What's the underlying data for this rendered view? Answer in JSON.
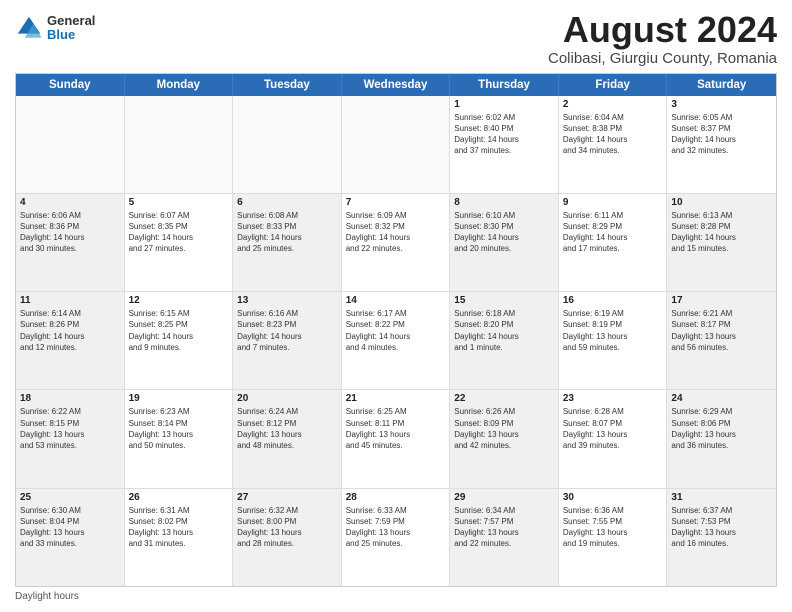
{
  "logo": {
    "general": "General",
    "blue": "Blue"
  },
  "title": "August 2024",
  "subtitle": "Colibasi, Giurgiu County, Romania",
  "calendar": {
    "headers": [
      "Sunday",
      "Monday",
      "Tuesday",
      "Wednesday",
      "Thursday",
      "Friday",
      "Saturday"
    ],
    "rows": [
      [
        {
          "day": "",
          "info": "",
          "empty": true
        },
        {
          "day": "",
          "info": "",
          "empty": true
        },
        {
          "day": "",
          "info": "",
          "empty": true
        },
        {
          "day": "",
          "info": "",
          "empty": true
        },
        {
          "day": "1",
          "info": "Sunrise: 6:02 AM\nSunset: 8:40 PM\nDaylight: 14 hours\nand 37 minutes."
        },
        {
          "day": "2",
          "info": "Sunrise: 6:04 AM\nSunset: 8:38 PM\nDaylight: 14 hours\nand 34 minutes."
        },
        {
          "day": "3",
          "info": "Sunrise: 6:05 AM\nSunset: 8:37 PM\nDaylight: 14 hours\nand 32 minutes."
        }
      ],
      [
        {
          "day": "4",
          "info": "Sunrise: 6:06 AM\nSunset: 8:36 PM\nDaylight: 14 hours\nand 30 minutes.",
          "shaded": true
        },
        {
          "day": "5",
          "info": "Sunrise: 6:07 AM\nSunset: 8:35 PM\nDaylight: 14 hours\nand 27 minutes."
        },
        {
          "day": "6",
          "info": "Sunrise: 6:08 AM\nSunset: 8:33 PM\nDaylight: 14 hours\nand 25 minutes.",
          "shaded": true
        },
        {
          "day": "7",
          "info": "Sunrise: 6:09 AM\nSunset: 8:32 PM\nDaylight: 14 hours\nand 22 minutes."
        },
        {
          "day": "8",
          "info": "Sunrise: 6:10 AM\nSunset: 8:30 PM\nDaylight: 14 hours\nand 20 minutes.",
          "shaded": true
        },
        {
          "day": "9",
          "info": "Sunrise: 6:11 AM\nSunset: 8:29 PM\nDaylight: 14 hours\nand 17 minutes."
        },
        {
          "day": "10",
          "info": "Sunrise: 6:13 AM\nSunset: 8:28 PM\nDaylight: 14 hours\nand 15 minutes.",
          "shaded": true
        }
      ],
      [
        {
          "day": "11",
          "info": "Sunrise: 6:14 AM\nSunset: 8:26 PM\nDaylight: 14 hours\nand 12 minutes.",
          "shaded": true
        },
        {
          "day": "12",
          "info": "Sunrise: 6:15 AM\nSunset: 8:25 PM\nDaylight: 14 hours\nand 9 minutes."
        },
        {
          "day": "13",
          "info": "Sunrise: 6:16 AM\nSunset: 8:23 PM\nDaylight: 14 hours\nand 7 minutes.",
          "shaded": true
        },
        {
          "day": "14",
          "info": "Sunrise: 6:17 AM\nSunset: 8:22 PM\nDaylight: 14 hours\nand 4 minutes."
        },
        {
          "day": "15",
          "info": "Sunrise: 6:18 AM\nSunset: 8:20 PM\nDaylight: 14 hours\nand 1 minute.",
          "shaded": true
        },
        {
          "day": "16",
          "info": "Sunrise: 6:19 AM\nSunset: 8:19 PM\nDaylight: 13 hours\nand 59 minutes."
        },
        {
          "day": "17",
          "info": "Sunrise: 6:21 AM\nSunset: 8:17 PM\nDaylight: 13 hours\nand 56 minutes.",
          "shaded": true
        }
      ],
      [
        {
          "day": "18",
          "info": "Sunrise: 6:22 AM\nSunset: 8:15 PM\nDaylight: 13 hours\nand 53 minutes.",
          "shaded": true
        },
        {
          "day": "19",
          "info": "Sunrise: 6:23 AM\nSunset: 8:14 PM\nDaylight: 13 hours\nand 50 minutes."
        },
        {
          "day": "20",
          "info": "Sunrise: 6:24 AM\nSunset: 8:12 PM\nDaylight: 13 hours\nand 48 minutes.",
          "shaded": true
        },
        {
          "day": "21",
          "info": "Sunrise: 6:25 AM\nSunset: 8:11 PM\nDaylight: 13 hours\nand 45 minutes."
        },
        {
          "day": "22",
          "info": "Sunrise: 6:26 AM\nSunset: 8:09 PM\nDaylight: 13 hours\nand 42 minutes.",
          "shaded": true
        },
        {
          "day": "23",
          "info": "Sunrise: 6:28 AM\nSunset: 8:07 PM\nDaylight: 13 hours\nand 39 minutes."
        },
        {
          "day": "24",
          "info": "Sunrise: 6:29 AM\nSunset: 8:06 PM\nDaylight: 13 hours\nand 36 minutes.",
          "shaded": true
        }
      ],
      [
        {
          "day": "25",
          "info": "Sunrise: 6:30 AM\nSunset: 8:04 PM\nDaylight: 13 hours\nand 33 minutes.",
          "shaded": true
        },
        {
          "day": "26",
          "info": "Sunrise: 6:31 AM\nSunset: 8:02 PM\nDaylight: 13 hours\nand 31 minutes."
        },
        {
          "day": "27",
          "info": "Sunrise: 6:32 AM\nSunset: 8:00 PM\nDaylight: 13 hours\nand 28 minutes.",
          "shaded": true
        },
        {
          "day": "28",
          "info": "Sunrise: 6:33 AM\nSunset: 7:59 PM\nDaylight: 13 hours\nand 25 minutes."
        },
        {
          "day": "29",
          "info": "Sunrise: 6:34 AM\nSunset: 7:57 PM\nDaylight: 13 hours\nand 22 minutes.",
          "shaded": true
        },
        {
          "day": "30",
          "info": "Sunrise: 6:36 AM\nSunset: 7:55 PM\nDaylight: 13 hours\nand 19 minutes."
        },
        {
          "day": "31",
          "info": "Sunrise: 6:37 AM\nSunset: 7:53 PM\nDaylight: 13 hours\nand 16 minutes.",
          "shaded": true
        }
      ]
    ]
  },
  "footer": {
    "note": "Daylight hours"
  }
}
